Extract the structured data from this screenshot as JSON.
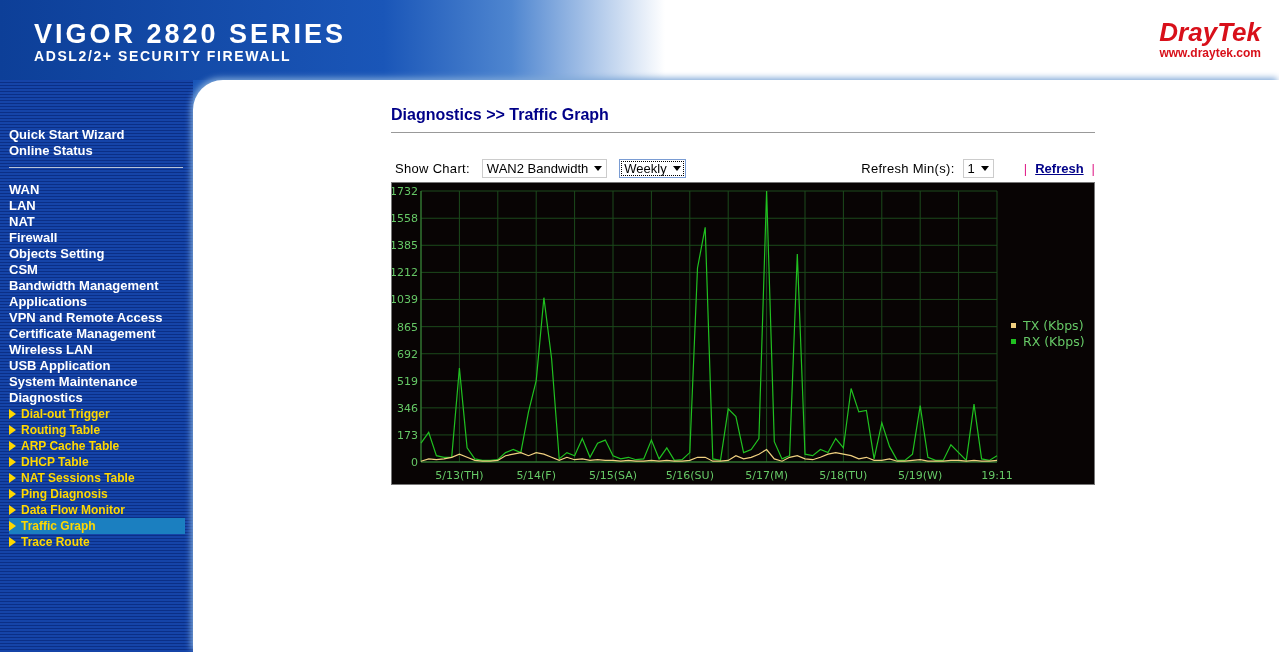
{
  "header": {
    "title": "VIGOR 2820 SERIES",
    "subtitle": "ADSL2/2+ SECURITY FIREWALL",
    "brand": "DrayTek",
    "website": "www.draytek.com"
  },
  "sidebar": {
    "quick_items": [
      "Quick Start Wizard",
      "Online Status"
    ],
    "items": [
      {
        "label": "WAN"
      },
      {
        "label": "LAN"
      },
      {
        "label": "NAT"
      },
      {
        "label": "Firewall"
      },
      {
        "label": "Objects Setting"
      },
      {
        "label": "CSM"
      },
      {
        "label": "Bandwidth Management"
      },
      {
        "label": "Applications"
      },
      {
        "label": "VPN and Remote Access"
      },
      {
        "label": "Certificate Management"
      },
      {
        "label": "Wireless LAN"
      },
      {
        "label": "USB Application"
      },
      {
        "label": "System Maintenance"
      },
      {
        "label": "Diagnostics",
        "children": [
          {
            "label": "Dial-out Trigger",
            "selected": false
          },
          {
            "label": "Routing Table",
            "selected": false
          },
          {
            "label": "ARP Cache Table",
            "selected": false
          },
          {
            "label": "DHCP Table",
            "selected": false
          },
          {
            "label": "NAT Sessions Table",
            "selected": false
          },
          {
            "label": "Ping Diagnosis",
            "selected": false
          },
          {
            "label": "Data Flow Monitor",
            "selected": false
          },
          {
            "label": "Traffic Graph",
            "selected": true
          },
          {
            "label": "Trace Route",
            "selected": false
          }
        ]
      }
    ]
  },
  "page": {
    "title": "Diagnostics >> Traffic Graph",
    "toolbar": {
      "show_chart_label": "Show Chart:",
      "chart_select": "WAN2 Bandwidth",
      "period_select": "Weekly",
      "refresh_label": "Refresh Min(s):",
      "refresh_select": "1",
      "separators": [
        "|",
        "|"
      ],
      "refresh_link": "Refresh"
    },
    "chart_data": {
      "type": "line",
      "categories": [
        null,
        null,
        null,
        null,
        null,
        "5/13(TH)",
        null,
        null,
        null,
        null,
        null,
        null,
        null,
        null,
        null,
        "5/14(F)",
        null,
        null,
        null,
        null,
        null,
        null,
        null,
        null,
        null,
        "5/15(SA)",
        null,
        null,
        null,
        null,
        null,
        null,
        null,
        null,
        null,
        "5/16(SU)",
        null,
        null,
        null,
        null,
        null,
        null,
        null,
        null,
        null,
        "5/17(M)",
        null,
        null,
        null,
        null,
        null,
        null,
        null,
        null,
        null,
        "5/18(TU)",
        null,
        null,
        null,
        null,
        null,
        null,
        null,
        null,
        null,
        "5/19(W)",
        null,
        null,
        null,
        null,
        null,
        null,
        null,
        null,
        null,
        "19:11"
      ],
      "series": [
        {
          "name": "TX (Kbps)",
          "color": "#f0d080",
          "values": [
            5,
            20,
            15,
            20,
            30,
            50,
            30,
            10,
            5,
            5,
            10,
            40,
            50,
            60,
            40,
            60,
            50,
            30,
            10,
            30,
            15,
            20,
            10,
            15,
            10,
            10,
            5,
            10,
            5,
            5,
            10,
            5,
            10,
            5,
            5,
            10,
            30,
            30,
            5,
            5,
            10,
            40,
            20,
            30,
            50,
            80,
            20,
            5,
            30,
            40,
            20,
            15,
            30,
            50,
            60,
            50,
            40,
            20,
            30,
            10,
            10,
            20,
            5,
            5,
            10,
            15,
            5,
            5,
            5,
            10,
            10,
            5,
            10,
            5,
            5,
            10
          ]
        },
        {
          "name": "RX (Kbps)",
          "color": "#20c020",
          "values": [
            120,
            190,
            40,
            30,
            30,
            600,
            90,
            20,
            10,
            10,
            15,
            60,
            80,
            60,
            320,
            520,
            1050,
            660,
            20,
            60,
            40,
            150,
            30,
            120,
            140,
            40,
            20,
            30,
            15,
            20,
            140,
            20,
            90,
            10,
            15,
            60,
            1240,
            1500,
            20,
            10,
            340,
            290,
            60,
            80,
            150,
            1732,
            130,
            20,
            40,
            1330,
            50,
            40,
            80,
            60,
            150,
            90,
            470,
            320,
            330,
            20,
            250,
            100,
            10,
            10,
            50,
            360,
            30,
            10,
            10,
            110,
            60,
            10,
            370,
            20,
            10,
            40
          ]
        }
      ],
      "grid": true,
      "legend": "right",
      "ylim": [
        0,
        1732
      ],
      "yticks": [
        0,
        173,
        346,
        519,
        692,
        865,
        1039,
        1212,
        1385,
        1558,
        1732
      ]
    }
  }
}
